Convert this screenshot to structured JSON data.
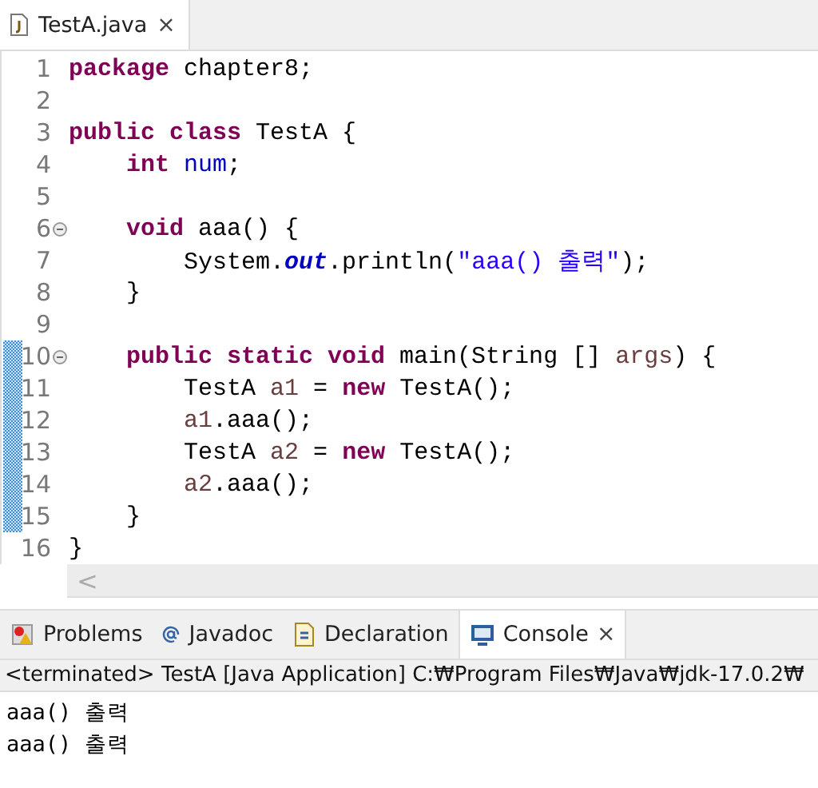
{
  "editor_tabs": [
    {
      "label": "TestA.java",
      "selected": true,
      "close": "×"
    }
  ],
  "lines": [
    {
      "number": "1",
      "fold": false,
      "changed": false,
      "tokens": [
        {
          "kind": "keyword",
          "text": "package"
        },
        {
          "kind": "plain",
          "text": " chapter8;"
        }
      ]
    },
    {
      "number": "2",
      "fold": false,
      "changed": false
    },
    {
      "number": "3",
      "fold": false,
      "changed": false,
      "tokens": [
        {
          "kind": "keyword",
          "text": "public"
        },
        {
          "kind": "keyword",
          "text": " class"
        },
        {
          "kind": "plain",
          "text": " TestA {"
        }
      ]
    },
    {
      "number": "4",
      "fold": false,
      "changed": false,
      "tokens": [
        {
          "kind": "keyword",
          "text": "    int"
        },
        {
          "kind": "field",
          "text": " num"
        },
        {
          "kind": "plain",
          "text": ";"
        }
      ]
    },
    {
      "number": "5",
      "fold": false,
      "changed": false
    },
    {
      "number": "6",
      "fold": true,
      "changed": false,
      "tokens": [
        {
          "kind": "keyword",
          "text": "    void"
        },
        {
          "kind": "plain",
          "text": " aaa() {"
        }
      ]
    },
    {
      "number": "7",
      "fold": false,
      "changed": false,
      "tokens": [
        {
          "kind": "plain",
          "text": "        System."
        },
        {
          "kind": "static",
          "text": "out"
        },
        {
          "kind": "plain",
          "text": ".println("
        },
        {
          "kind": "string",
          "text": "\"aaa() 출력\""
        },
        {
          "kind": "plain",
          "text": ");"
        }
      ]
    },
    {
      "number": "8",
      "fold": false,
      "changed": false,
      "tokens": [
        {
          "kind": "plain",
          "text": "    }"
        }
      ]
    },
    {
      "number": "9",
      "fold": false,
      "changed": false
    },
    {
      "number": "10",
      "fold": true,
      "changed": true,
      "tokens": [
        {
          "kind": "keyword",
          "text": "    public"
        },
        {
          "kind": "keyword",
          "text": " static"
        },
        {
          "kind": "keyword",
          "text": " void"
        },
        {
          "kind": "plain",
          "text": " main(String [] "
        },
        {
          "kind": "local",
          "text": "args"
        },
        {
          "kind": "plain",
          "text": ") {"
        }
      ]
    },
    {
      "number": "11",
      "fold": false,
      "changed": true,
      "tokens": [
        {
          "kind": "plain",
          "text": "        TestA "
        },
        {
          "kind": "local",
          "text": "a1"
        },
        {
          "kind": "plain",
          "text": " = "
        },
        {
          "kind": "keyword",
          "text": "new"
        },
        {
          "kind": "plain",
          "text": " TestA();"
        }
      ]
    },
    {
      "number": "12",
      "fold": false,
      "changed": true,
      "tokens": [
        {
          "kind": "local",
          "text": "        a1"
        },
        {
          "kind": "plain",
          "text": ".aaa();"
        }
      ]
    },
    {
      "number": "13",
      "fold": false,
      "changed": true,
      "tokens": [
        {
          "kind": "plain",
          "text": "        TestA "
        },
        {
          "kind": "local",
          "text": "a2"
        },
        {
          "kind": "plain",
          "text": " = "
        },
        {
          "kind": "keyword",
          "text": "new"
        },
        {
          "kind": "plain",
          "text": " TestA();"
        }
      ]
    },
    {
      "number": "14",
      "fold": false,
      "changed": true,
      "tokens": [
        {
          "kind": "local",
          "text": "        a2"
        },
        {
          "kind": "plain",
          "text": ".aaa();"
        }
      ]
    },
    {
      "number": "15",
      "fold": false,
      "changed": true,
      "tokens": [
        {
          "kind": "plain",
          "text": "    }"
        }
      ]
    },
    {
      "number": "16",
      "fold": false,
      "changed": false,
      "tokens": [
        {
          "kind": "plain",
          "text": "}"
        }
      ]
    }
  ],
  "scroll_left": "<",
  "panel_tabs": [
    {
      "kind": "problems",
      "label": "Problems",
      "selected": false
    },
    {
      "kind": "javadoc",
      "label": "Javadoc",
      "selected": false
    },
    {
      "kind": "declaration",
      "label": "Declaration",
      "selected": false
    },
    {
      "kind": "console",
      "label": "Console",
      "selected": true,
      "close": "×"
    }
  ],
  "console": {
    "header": "<terminated> TestA [Java Application] C:₩Program Files₩Java₩jdk-17.0.2₩",
    "output": [
      "aaa() 출력",
      "aaa() 출력"
    ]
  }
}
